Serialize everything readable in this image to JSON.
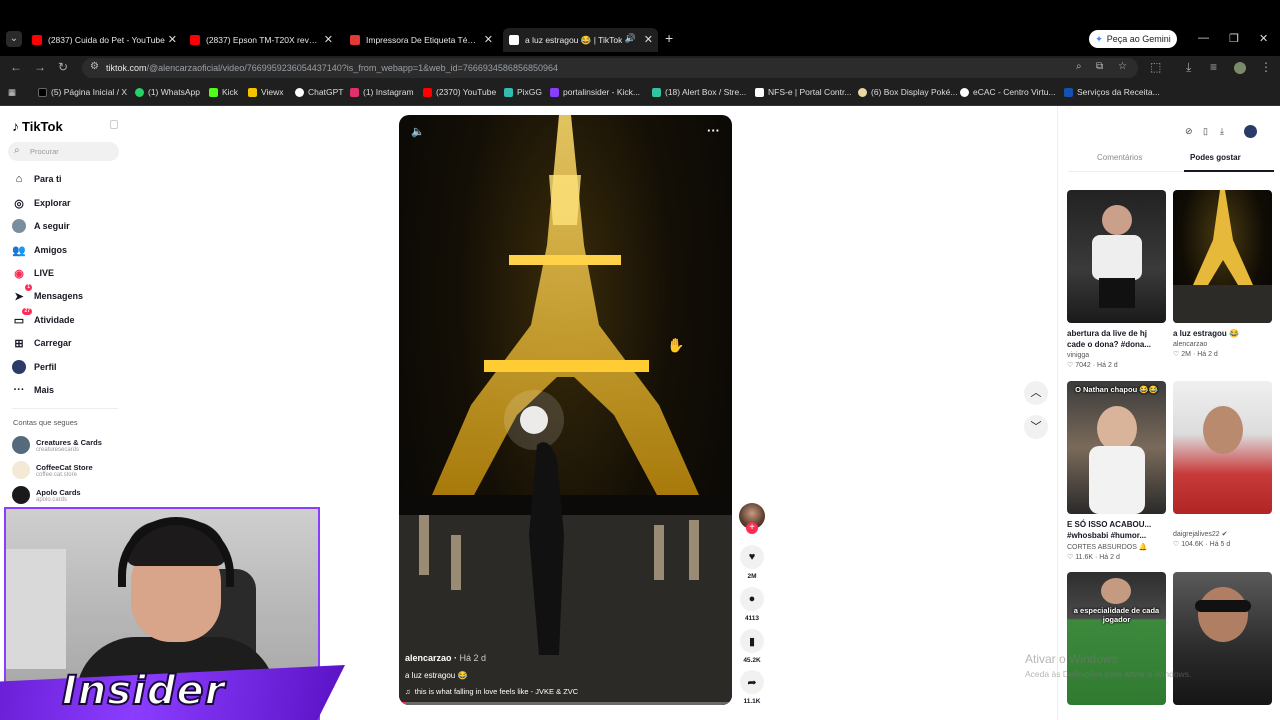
{
  "browser": {
    "tabs": [
      {
        "title": "(2837) Cuida do Pet - YouTube",
        "color": "#ff0000"
      },
      {
        "title": "(2837) Epson TM-T20X review",
        "color": "#ff0000"
      },
      {
        "title": "Impressora De Etiqueta Térmica",
        "color": "#e53935"
      },
      {
        "title": "a luz estragou 😂 | TikTok",
        "color": "#ffffff"
      }
    ],
    "gemini_label": "Peça ao Gemini",
    "url_host": "tiktok.com",
    "url_path": "/@alencarzaoficial/video/7669959236054437140?is_from_webapp=1&web_id=7666934586856850964",
    "bookmarks": [
      "(5) Página Inicial / X",
      "(1) WhatsApp",
      "Kick",
      "Viewx",
      "ChatGPT",
      "(1) Instagram",
      "(2370) YouTube",
      "PixGG",
      "portalinsider - Kick...",
      "(18) Alert Box / Stre...",
      "NFS-e | Portal Contr...",
      "(6) Box Display Poké...",
      "eCAC - Centro Virtu...",
      "Serviços da Receita..."
    ]
  },
  "sidebar": {
    "logo": "TikTok",
    "search_placeholder": "Procurar",
    "nav": [
      {
        "label": "Para ti",
        "icon": "home-icon"
      },
      {
        "label": "Explorar",
        "icon": "compass-icon"
      },
      {
        "label": "A seguir",
        "icon": "following-icon"
      },
      {
        "label": "Amigos",
        "icon": "friends-icon"
      },
      {
        "label": "LIVE",
        "icon": "live-icon"
      },
      {
        "label": "Mensagens",
        "icon": "message-icon",
        "badge": "1"
      },
      {
        "label": "Atividade",
        "icon": "activity-icon",
        "badge": "27"
      },
      {
        "label": "Carregar",
        "icon": "upload-icon"
      },
      {
        "label": "Perfil",
        "icon": "profile-icon"
      },
      {
        "label": "Mais",
        "icon": "more-icon"
      }
    ],
    "follows_title": "Contas que segues",
    "follows": [
      {
        "name": "Creatures & Cards",
        "handle": "creaturesecards"
      },
      {
        "name": "CoffeeCat Store",
        "handle": "coffee.cat.store"
      },
      {
        "name": "Apolo Cards",
        "handle": "apolo.cards"
      }
    ]
  },
  "overlay": {
    "brand": "Insider"
  },
  "video": {
    "author": "alencarzao",
    "ago": "Há 2 d",
    "caption": "a luz estragou 😂",
    "music": "this is what falling in love feels like - JVKE & ZVC",
    "progress": 0.02
  },
  "actions": {
    "likes": "2M",
    "comments": "4113",
    "saves": "45.2K",
    "shares": "11.1K"
  },
  "panel": {
    "tabs": [
      "Comentários",
      "Podes gostar"
    ],
    "active_tab": "Podes gostar",
    "cards": [
      {
        "title": "abertura da live de hj cade o dona? #dona...",
        "author": "vinigga",
        "likes": "7042",
        "ago": "Há 2 d"
      },
      {
        "title": "a luz estragou 😂",
        "author": "alencarzao",
        "likes": "2M",
        "ago": "Há 2 d"
      },
      {
        "title": "E SÓ ISSO ACABOU... #whosbabi #humor...",
        "author": "CORTES ABSURDOS 🔔",
        "likes": "11.6K",
        "ago": "Há 2 d",
        "overlay": "O Nathan chapou 😂😂"
      },
      {
        "title": "",
        "author": "daigrejalives22 ✔",
        "likes": "104.6K",
        "ago": "Há 5 d"
      },
      {
        "title": "",
        "author": "",
        "likes": "",
        "ago": "",
        "overlay": "a especialidade de cada jogador"
      },
      {
        "title": "",
        "author": "",
        "likes": "",
        "ago": ""
      }
    ]
  },
  "windows": {
    "watermark_title": "Ativar o Windows",
    "watermark_sub": "Aceda às Definições para ativar o Windows."
  },
  "colors": {
    "accent": "#fe2c55",
    "brand_purple": "#8b3dff"
  }
}
